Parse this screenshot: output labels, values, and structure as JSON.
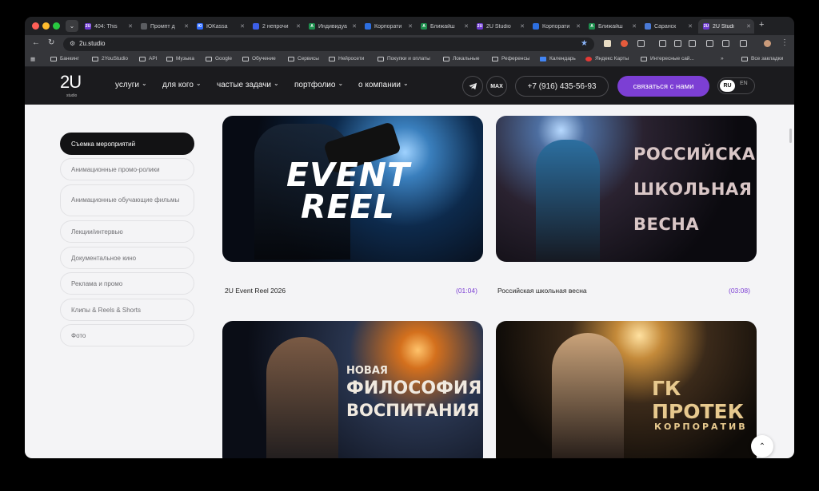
{
  "browser": {
    "tabs": [
      {
        "title": "404: This",
        "active": false,
        "fav_color": "#6e3ad1",
        "fav": "2U"
      },
      {
        "title": "Промпт д",
        "active": false,
        "fav_color": "#5b5d61",
        "fav": ""
      },
      {
        "title": "ЮKassa",
        "active": false,
        "fav_color": "#2f6bff",
        "fav": "Ю"
      },
      {
        "title": "2 непрочи",
        "active": false,
        "fav_color": "#3c5fe8",
        "fav": ""
      },
      {
        "title": "Индивидуа",
        "active": false,
        "fav_color": "#1e8f4e",
        "fav": "A"
      },
      {
        "title": "Корпорати",
        "active": false,
        "fav_color": "#2d6fe0",
        "fav": ""
      },
      {
        "title": "Ближайш",
        "active": false,
        "fav_color": "#1e8f4e",
        "fav": "A"
      },
      {
        "title": "2U Studio",
        "active": false,
        "fav_color": "#6e3ad1",
        "fav": "2U"
      },
      {
        "title": "Корпорати",
        "active": false,
        "fav_color": "#2d6fe0",
        "fav": ""
      },
      {
        "title": "Ближайш",
        "active": false,
        "fav_color": "#1e8f4e",
        "fav": "A"
      },
      {
        "title": "Саранск",
        "active": false,
        "fav_color": "#4a7ad6",
        "fav": ""
      },
      {
        "title": "2U Studi",
        "active": true,
        "fav_color": "#6e3ad1",
        "fav": "2U"
      }
    ],
    "url": "2u.studio",
    "bookmarks": [
      "Банкинг",
      "2YouStudio",
      "API",
      "Музыка",
      "Google",
      "Обучение",
      "Сервисы",
      "Нейросети",
      "Покупки и оплаты",
      "Локальные",
      "Референсы",
      "Календарь",
      "Яндекс Карты",
      "Интересные сай...",
      "Все закладки"
    ]
  },
  "site": {
    "logo": "2U",
    "logo_sub": "studio",
    "menu": [
      "услуги",
      "для кого",
      "частые задачи",
      "портфолио",
      "о компании"
    ],
    "max_label": "MAX",
    "phone": "+7 (916) 435-56-93",
    "cta": "связаться с нами",
    "lang_active": "RU",
    "lang_other": "EN",
    "accent": "#7c3fd4"
  },
  "categories": [
    "Съемка мероприятий",
    "Анимационные промо-ролики",
    "Анимационные обучающие фильмы",
    "Лекции/интервью",
    "Документальное кино",
    "Реклама и промо",
    "Клипы & Reels & Shorts",
    "Фото"
  ],
  "videos": [
    {
      "title": "2U Event Reel 2026",
      "duration": "(01:04)",
      "art": [
        "EVENT",
        "REEL"
      ]
    },
    {
      "title": "Российская школьная весна",
      "duration": "(03:08)",
      "art": [
        "РОССИЙСКАЯ",
        "ШКОЛЬНАЯ",
        "ВЕСНА"
      ]
    },
    {
      "title": "",
      "duration": "",
      "art": [
        "НОВАЯ",
        "ФИЛОСОФИЯ",
        "ВОСПИТАНИЯ"
      ]
    },
    {
      "title": "",
      "duration": "",
      "art": [
        "ГК ПРОТЕК",
        "КОРПОРАТИВ"
      ]
    }
  ]
}
